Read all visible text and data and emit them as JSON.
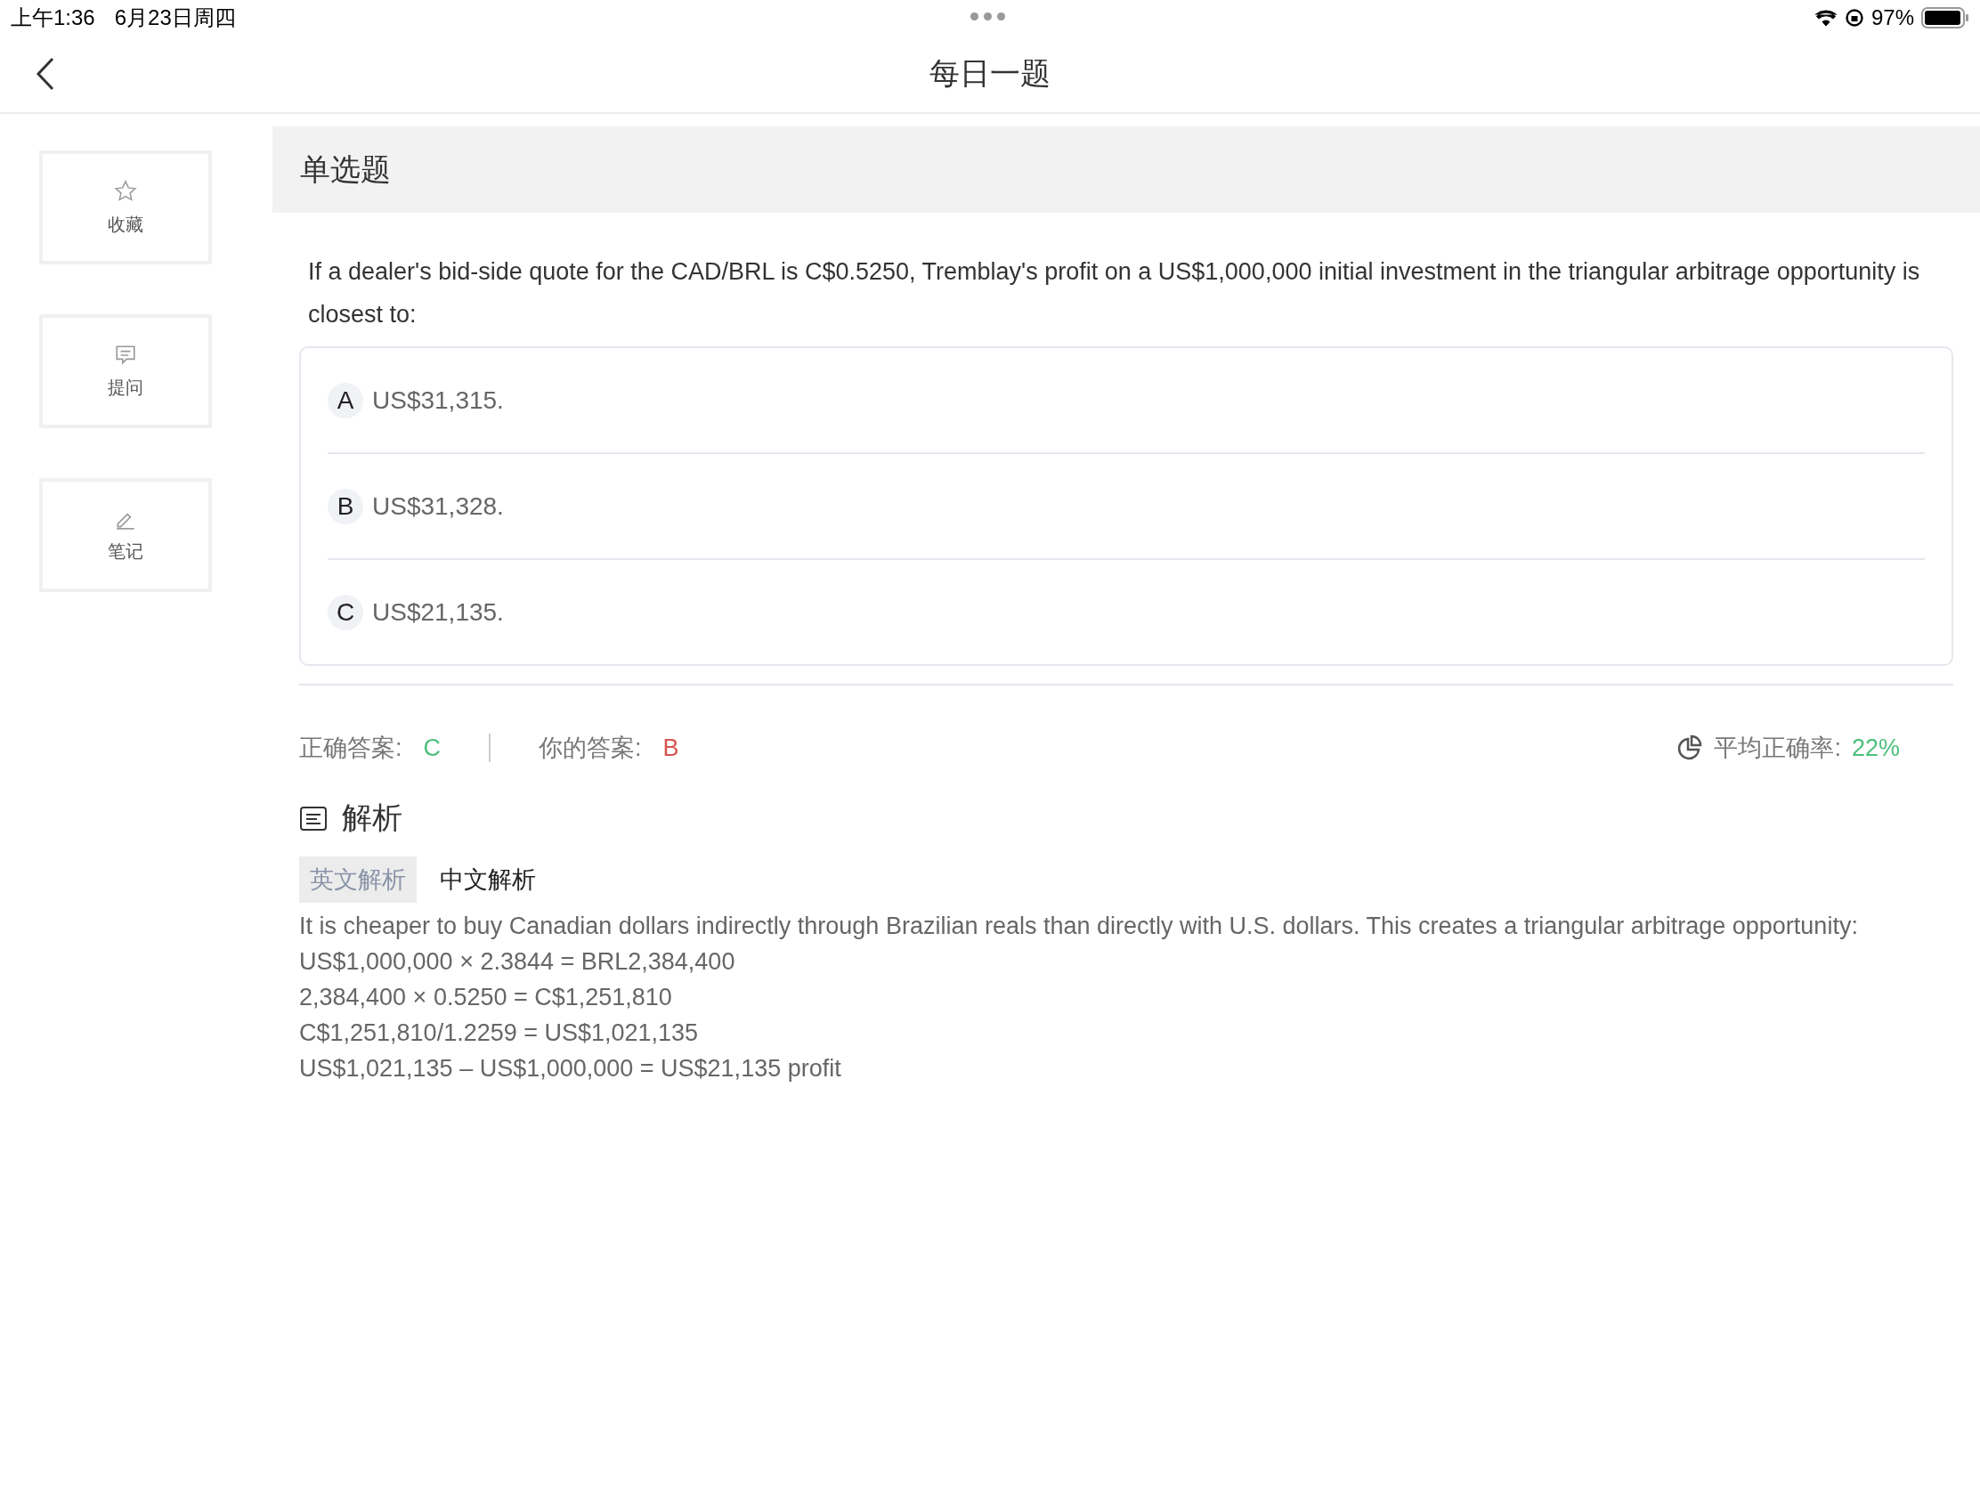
{
  "status_bar": {
    "time": "上午1:36",
    "date": "6月23日周四",
    "battery": "97%"
  },
  "nav": {
    "title": "每日一题"
  },
  "sidebar": {
    "items": [
      {
        "kind": "star",
        "label": "收藏"
      },
      {
        "kind": "comment",
        "label": "提问"
      },
      {
        "kind": "note",
        "label": "笔记"
      }
    ]
  },
  "question": {
    "type": "单选题",
    "text": "If a dealer's bid-side quote for the CAD/BRL is C$0.5250, Tremblay's profit on a US$1,000,000 initial investment in the triangular arbitrage opportunity is closest to:",
    "options": [
      {
        "letter": "A",
        "text": "US$31,315."
      },
      {
        "letter": "B",
        "text": "US$31,328."
      },
      {
        "letter": "C",
        "text": "US$21,135."
      }
    ]
  },
  "result": {
    "correct_label": "正确答案:",
    "correct_value": "C",
    "your_label": "你的答案:",
    "your_value": "B",
    "your_correct": false,
    "average_label": "平均正确率:",
    "average_value": "22%"
  },
  "analysis": {
    "title": "解析",
    "tabs": [
      {
        "label": "英文解析",
        "selected": true
      },
      {
        "label": "中文解析",
        "selected": false
      }
    ],
    "lines": [
      "It is cheaper to buy Canadian dollars indirectly through Brazilian reals than directly with U.S. dollars. This creates a triangular arbitrage opportunity:",
      "US$1,000,000 × 2.3844 = BRL2,384,400",
      "2,384,400 × 0.5250 = C$1,251,810",
      "C$1,251,810/1.2259 = US$1,021,135",
      "US$1,021,135 – US$1,000,000 = US$21,135 profit"
    ]
  }
}
